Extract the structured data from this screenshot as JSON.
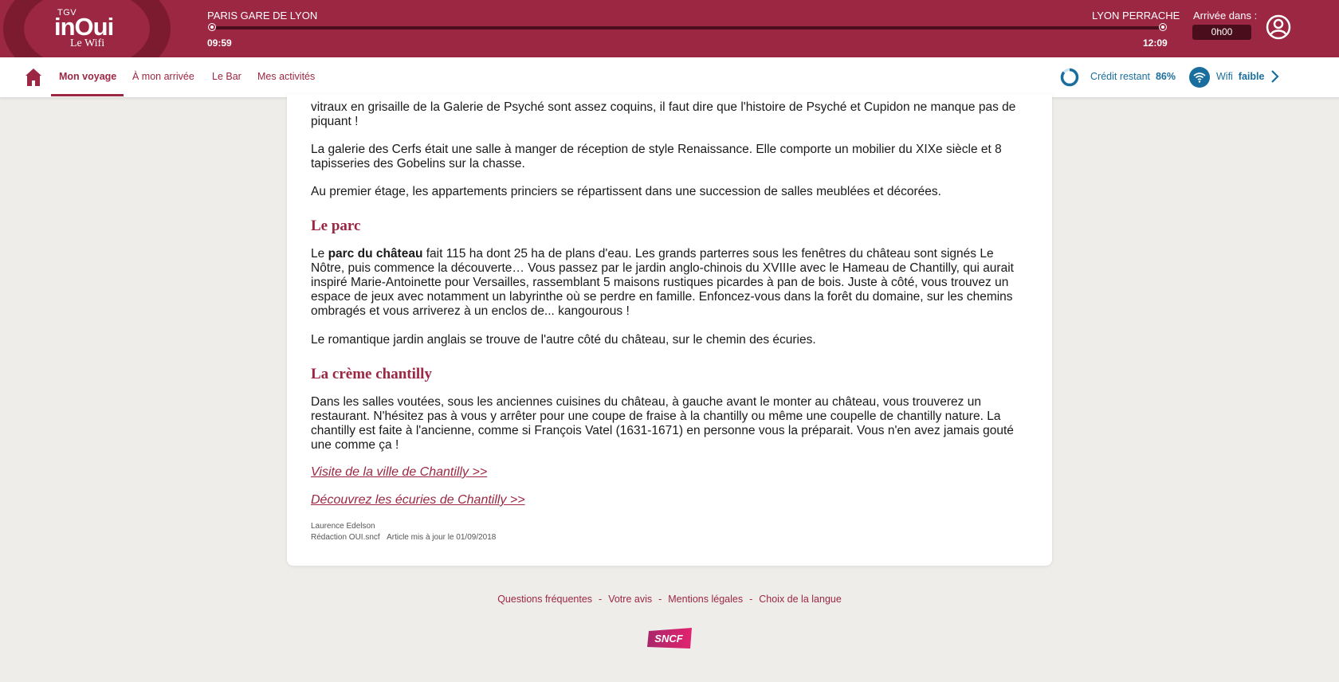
{
  "header": {
    "logo_tgv": "TGV",
    "logo_brand": "inOui",
    "logo_sub": "Le Wifi",
    "departure_station": "PARIS GARE DE LYON",
    "departure_time": "09:59",
    "arrival_station": "LYON PERRACHE",
    "arrival_time": "12:09",
    "arrival_in_label": "Arrivée dans :",
    "arrival_in_value": "0h00"
  },
  "nav": {
    "items": [
      {
        "label": "Mon voyage"
      },
      {
        "label": "À mon arrivée"
      },
      {
        "label": "Le Bar"
      },
      {
        "label": "Mes activités"
      }
    ],
    "credit_label": "Crédit restant",
    "credit_value": "86%",
    "wifi_label": "Wifi",
    "wifi_strength": "faible"
  },
  "article": {
    "p_intro": "vitraux en grisaille de la Galerie de Psyché sont assez coquins, il faut dire que l'histoire de Psyché et Cupidon ne manque pas de piquant !",
    "p_cerfs": "La galerie des Cerfs était une salle à manger de réception de style Renaissance. Elle comporte un mobilier du XIXe siècle et 8 tapisseries des Gobelins sur la chasse.",
    "p_etage": "Au premier étage, les appartements princiers se répartissent dans une succession de salles meublées et décorées.",
    "h_parc": "Le parc",
    "p_parc_start": "Le ",
    "p_parc_bold": "parc du château",
    "p_parc_rest": " fait 115 ha dont 25 ha de plans d'eau. Les grands parterres sous les fenêtres du château sont signés Le Nôtre, puis commence la découverte… Vous passez par le jardin anglo-chinois du XVIIIe avec le Hameau de Chantilly, qui aurait inspiré Marie-Antoinette pour Versailles, rassemblant 5 maisons rustiques picardes à pan de bois. Juste à côté, vous trouvez un espace de jeux avec notamment un labyrinthe où se perdre en famille. Enfoncez-vous dans la forêt du domaine, sur les chemins ombragés et vous arriverez à un enclos de... kangourous !",
    "p_jardin": "Le romantique jardin anglais se trouve de l'autre côté du château, sur le chemin des écuries.",
    "h_creme": "La crème chantilly",
    "p_creme": "Dans les salles voutées, sous les anciennes cuisines du château, à gauche avant le monter au château, vous trouverez un restaurant. N'hésitez pas à vous y arrêter pour une coupe de fraise à la chantilly ou même une coupelle de chantilly nature. La chantilly est faite à l'ancienne, comme si François Vatel (1631-1671) en personne vous la préparait. Vous n'en avez jamais gouté une comme ça !",
    "link_ville": "Visite de la ville de Chantilly >>",
    "link_ecuries": "Découvrez les écuries de Chantilly >>",
    "author": "Laurence Edelson",
    "redaction": "Rédaction OUI.sncf",
    "updated": "Article mis à jour le 01/09/2018"
  },
  "footer": {
    "links": [
      "Questions fréquentes",
      "Votre avis",
      "Mentions légales",
      "Choix de la langue"
    ],
    "separator": "-",
    "brand": "SNCF"
  },
  "colors": {
    "brand": "#9b2743",
    "brand_dark": "#4a0d1c",
    "wifi_blue": "#1a6e9e",
    "page_bg": "#efedea"
  }
}
